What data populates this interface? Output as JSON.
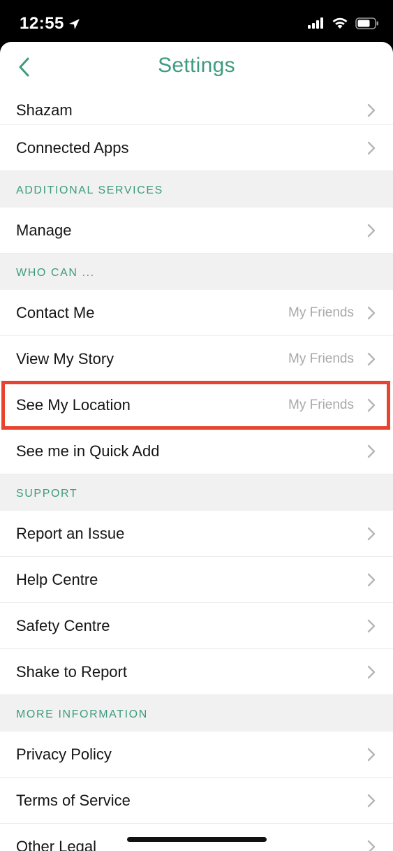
{
  "status": {
    "time": "12:55",
    "location_icon": "location-arrow-icon",
    "signal_icon": "cellular-signal-icon",
    "wifi_icon": "wifi-icon",
    "battery_icon": "battery-icon"
  },
  "nav": {
    "title": "Settings",
    "back_icon": "chevron-left-icon"
  },
  "rows": [
    {
      "label": "Shazam"
    },
    {
      "label": "Connected Apps"
    }
  ],
  "sections": {
    "additional_services": {
      "title": "ADDITIONAL SERVICES",
      "rows": [
        {
          "label": "Manage"
        }
      ]
    },
    "who_can": {
      "title": "WHO CAN ...",
      "rows": [
        {
          "label": "Contact Me",
          "value": "My Friends"
        },
        {
          "label": "View My Story",
          "value": "My Friends"
        },
        {
          "label": "See My Location",
          "value": "My Friends"
        },
        {
          "label": "See me in Quick Add"
        }
      ]
    },
    "support": {
      "title": "SUPPORT",
      "rows": [
        {
          "label": "Report an Issue"
        },
        {
          "label": "Help Centre"
        },
        {
          "label": "Safety Centre"
        },
        {
          "label": "Shake to Report"
        }
      ]
    },
    "more_information": {
      "title": "MORE INFORMATION",
      "rows": [
        {
          "label": "Privacy Policy"
        },
        {
          "label": "Terms of Service"
        },
        {
          "label": "Other Legal"
        }
      ]
    }
  },
  "colors": {
    "accent": "#3d9b7f",
    "highlight": "#e8432e",
    "section_bg": "#f1f1f1",
    "value_text": "#a8a8a8"
  }
}
